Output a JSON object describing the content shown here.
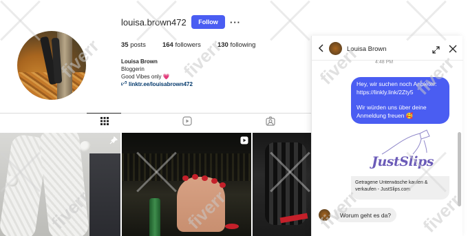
{
  "profile": {
    "username": "louisa.brown472",
    "follow_label": "Follow",
    "more_label": "···",
    "stats": {
      "posts_count": "35",
      "posts_label": "posts",
      "followers_count": "164",
      "followers_label": "followers",
      "following_count": "130",
      "following_label": "following"
    },
    "bio": {
      "full_name": "Louisa Brown",
      "line1": "Bloggerin",
      "line2": "Good Vibes only 💗",
      "link": "linktr.ee/louisabrown472"
    }
  },
  "tabs": [
    {
      "name": "posts",
      "icon": "grid-icon",
      "active": true
    },
    {
      "name": "reels",
      "icon": "reels-icon",
      "active": false
    },
    {
      "name": "tagged",
      "icon": "tagged-icon",
      "active": false
    }
  ],
  "grid": [
    {
      "icon": "pin-icon"
    },
    {
      "icon": "reel-play-icon"
    },
    {
      "icon": ""
    }
  ],
  "chat": {
    "name": "Louisa Brown",
    "time": "4:48 PM",
    "outgoing": {
      "line1": "Hey, wir suchen noch Anbieter:",
      "line2": "https://linkly.link/2Zty5",
      "line3": "Wir würden uns über deine Anmeldung freuen 🥰"
    },
    "card": {
      "brand": "JustSlips",
      "text": "Getragene Unterwäsche kaufen & verkaufen - JustSlips.com"
    },
    "incoming": "Worum geht es da?"
  },
  "watermark": "fiverr",
  "colors": {
    "accent": "#4a5df2",
    "link": "#00376b",
    "brand_purple": "#6b5bb8"
  }
}
